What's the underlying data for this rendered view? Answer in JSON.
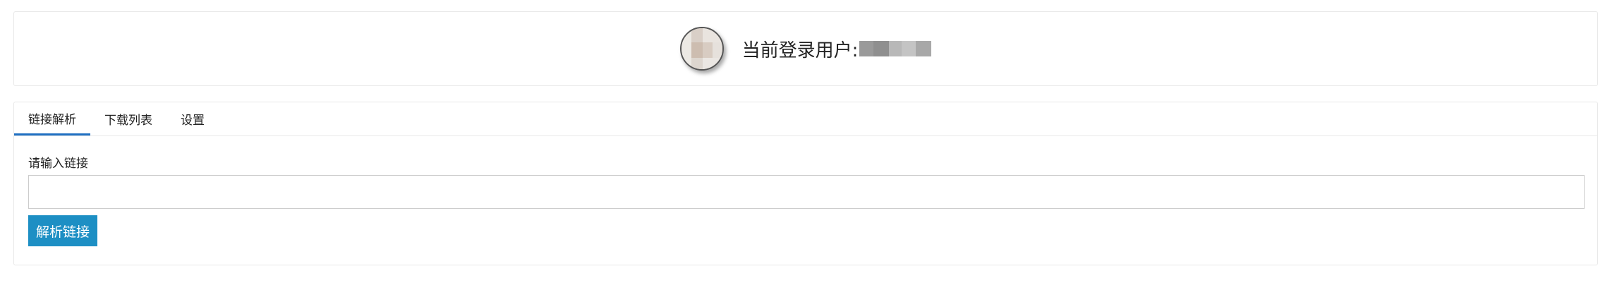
{
  "header": {
    "current_user_label": "当前登录用户:"
  },
  "tabs": [
    {
      "label": "链接解析",
      "active": true
    },
    {
      "label": "下载列表",
      "active": false
    },
    {
      "label": "设置",
      "active": false
    }
  ],
  "form": {
    "link_label": "请输入链接",
    "link_value": "",
    "link_placeholder": "",
    "parse_button": "解析链接"
  },
  "colors": {
    "accent": "#1f6fc2",
    "button_bg": "#1d8fc4",
    "border": "#e8e8e8"
  }
}
